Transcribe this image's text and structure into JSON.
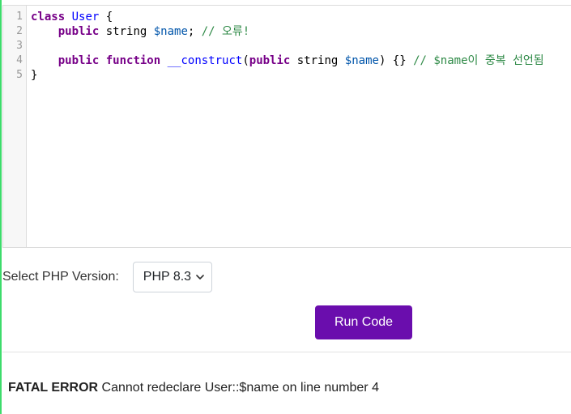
{
  "editor": {
    "line_numbers": [
      "1",
      "2",
      "3",
      "4",
      "5"
    ],
    "lines": [
      [
        {
          "t": "class",
          "c": "kw"
        },
        {
          "t": " ",
          "c": "plain"
        },
        {
          "t": "User",
          "c": "def"
        },
        {
          "t": " {",
          "c": "plain"
        }
      ],
      [
        {
          "t": "    ",
          "c": "plain"
        },
        {
          "t": "public",
          "c": "kw"
        },
        {
          "t": " string ",
          "c": "plain"
        },
        {
          "t": "$name",
          "c": "var"
        },
        {
          "t": "; ",
          "c": "plain"
        },
        {
          "t": "// 오류!",
          "c": "cm green"
        }
      ],
      [
        {
          "t": "",
          "c": "plain"
        }
      ],
      [
        {
          "t": "    ",
          "c": "plain"
        },
        {
          "t": "public",
          "c": "kw"
        },
        {
          "t": " ",
          "c": "plain"
        },
        {
          "t": "function",
          "c": "kw"
        },
        {
          "t": " ",
          "c": "plain"
        },
        {
          "t": "__construct",
          "c": "def"
        },
        {
          "t": "(",
          "c": "plain"
        },
        {
          "t": "public",
          "c": "kw"
        },
        {
          "t": " string ",
          "c": "plain"
        },
        {
          "t": "$name",
          "c": "var"
        },
        {
          "t": ") {} ",
          "c": "plain"
        },
        {
          "t": "// $name이 중복 선언됨",
          "c": "cm green"
        }
      ],
      [
        {
          "t": "}",
          "c": "plain"
        }
      ]
    ]
  },
  "version": {
    "label": "Select PHP Version:",
    "selected": "PHP 8.3"
  },
  "run_button": {
    "label": "Run Code"
  },
  "output": {
    "error_label": "FATAL ERROR",
    "message": " Cannot redeclare User::$name on line number 4"
  },
  "colors": {
    "accent": "#6a0dad",
    "left_bar": "#3ddc6b"
  }
}
